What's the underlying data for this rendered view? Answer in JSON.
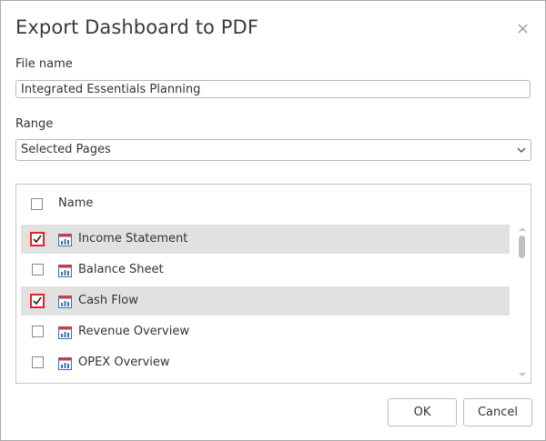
{
  "dialog": {
    "title": "Export Dashboard to PDF",
    "close_icon": "close-icon"
  },
  "file_name": {
    "label": "File name",
    "value": "Integrated Essentials Planning"
  },
  "range": {
    "label": "Range",
    "selected": "Selected Pages"
  },
  "pages": {
    "header": "Name",
    "header_checked": false,
    "items": [
      {
        "label": "Income Statement",
        "checked": true,
        "selected": true
      },
      {
        "label": "Balance Sheet",
        "checked": false,
        "selected": false
      },
      {
        "label": "Cash Flow",
        "checked": true,
        "selected": true
      },
      {
        "label": "Revenue Overview",
        "checked": false,
        "selected": false
      },
      {
        "label": "OPEX Overview",
        "checked": false,
        "selected": false
      }
    ]
  },
  "buttons": {
    "ok": "OK",
    "cancel": "Cancel"
  },
  "colors": {
    "check_border": "#e8202a",
    "selected_row": "#e1e1e1",
    "page_icon_blue": "#3b6fb3",
    "page_icon_red": "#d7393f"
  }
}
